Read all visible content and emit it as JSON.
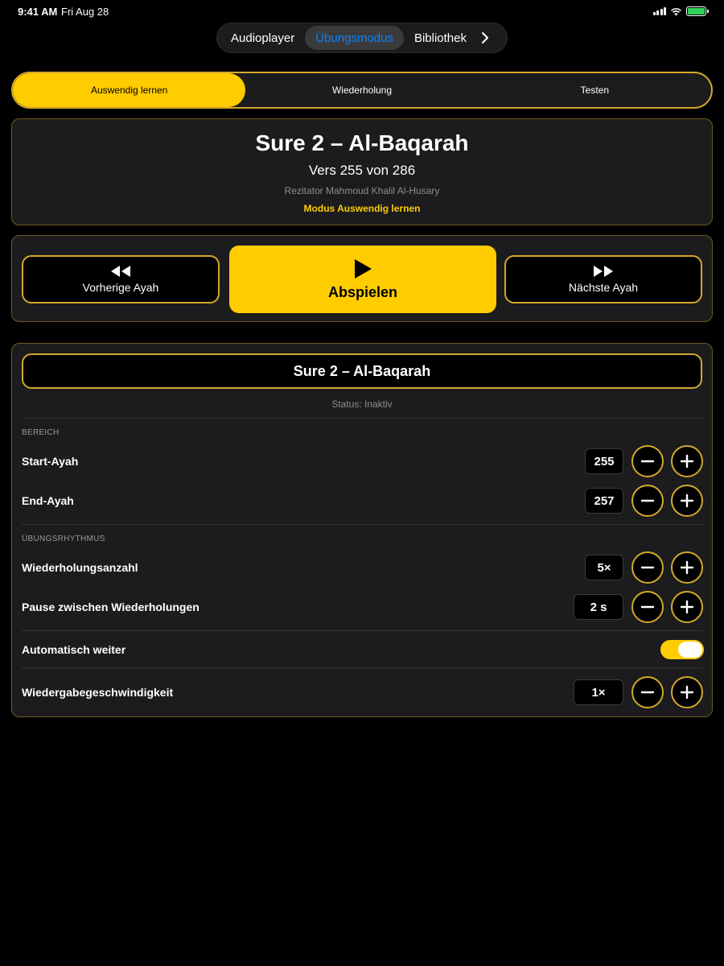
{
  "status_bar": {
    "time": "9:41 AM",
    "date": "Fri Aug 28",
    "battery_color": "#30d158"
  },
  "top_nav": {
    "tabs": [
      {
        "label": "Audioplayer",
        "active": false
      },
      {
        "label": "Übungsmodus",
        "active": true
      },
      {
        "label": "Bibliothek",
        "active": false
      }
    ],
    "more_icon": "chevron-right-icon"
  },
  "mode_tabs": [
    {
      "label": "Auswendig lernen",
      "active": true
    },
    {
      "label": "Wiederholung",
      "active": false
    },
    {
      "label": "Testen",
      "active": false
    }
  ],
  "info": {
    "title": "Sure 2 – Al-Baqarah",
    "verse": "Vers 255 von 286",
    "reciter": "Rezitator Mahmoud Khalil Al-Husary",
    "mode": "Modus Auswendig lernen"
  },
  "controls": {
    "prev_label": "Vorherige Ayah",
    "play_label": "Abspielen",
    "next_label": "Nächste Ayah"
  },
  "settings": {
    "surah_button": "Sure 2 – Al-Baqarah",
    "status": "Status: Inaktiv",
    "section_range": "BEREICH",
    "start_label": "Start-Ayah",
    "start_value": "255",
    "end_label": "End-Ayah",
    "end_value": "257",
    "section_rhythm": "ÜBUNGSRHYTHMUS",
    "repeat_label": "Wiederholungsanzahl",
    "repeat_value": "5×",
    "pause_label": "Pause zwischen Wiederholungen",
    "pause_value": "2 s",
    "auto_label": "Automatisch weiter",
    "auto_on": true,
    "speed_label": "Wiedergabegeschwindigkeit",
    "speed_value": "1×"
  },
  "colors": {
    "accent": "#ffcc00",
    "border": "#d4a82a",
    "active_tab_text": "#0a84ff",
    "card_bg": "#1c1c1e"
  }
}
